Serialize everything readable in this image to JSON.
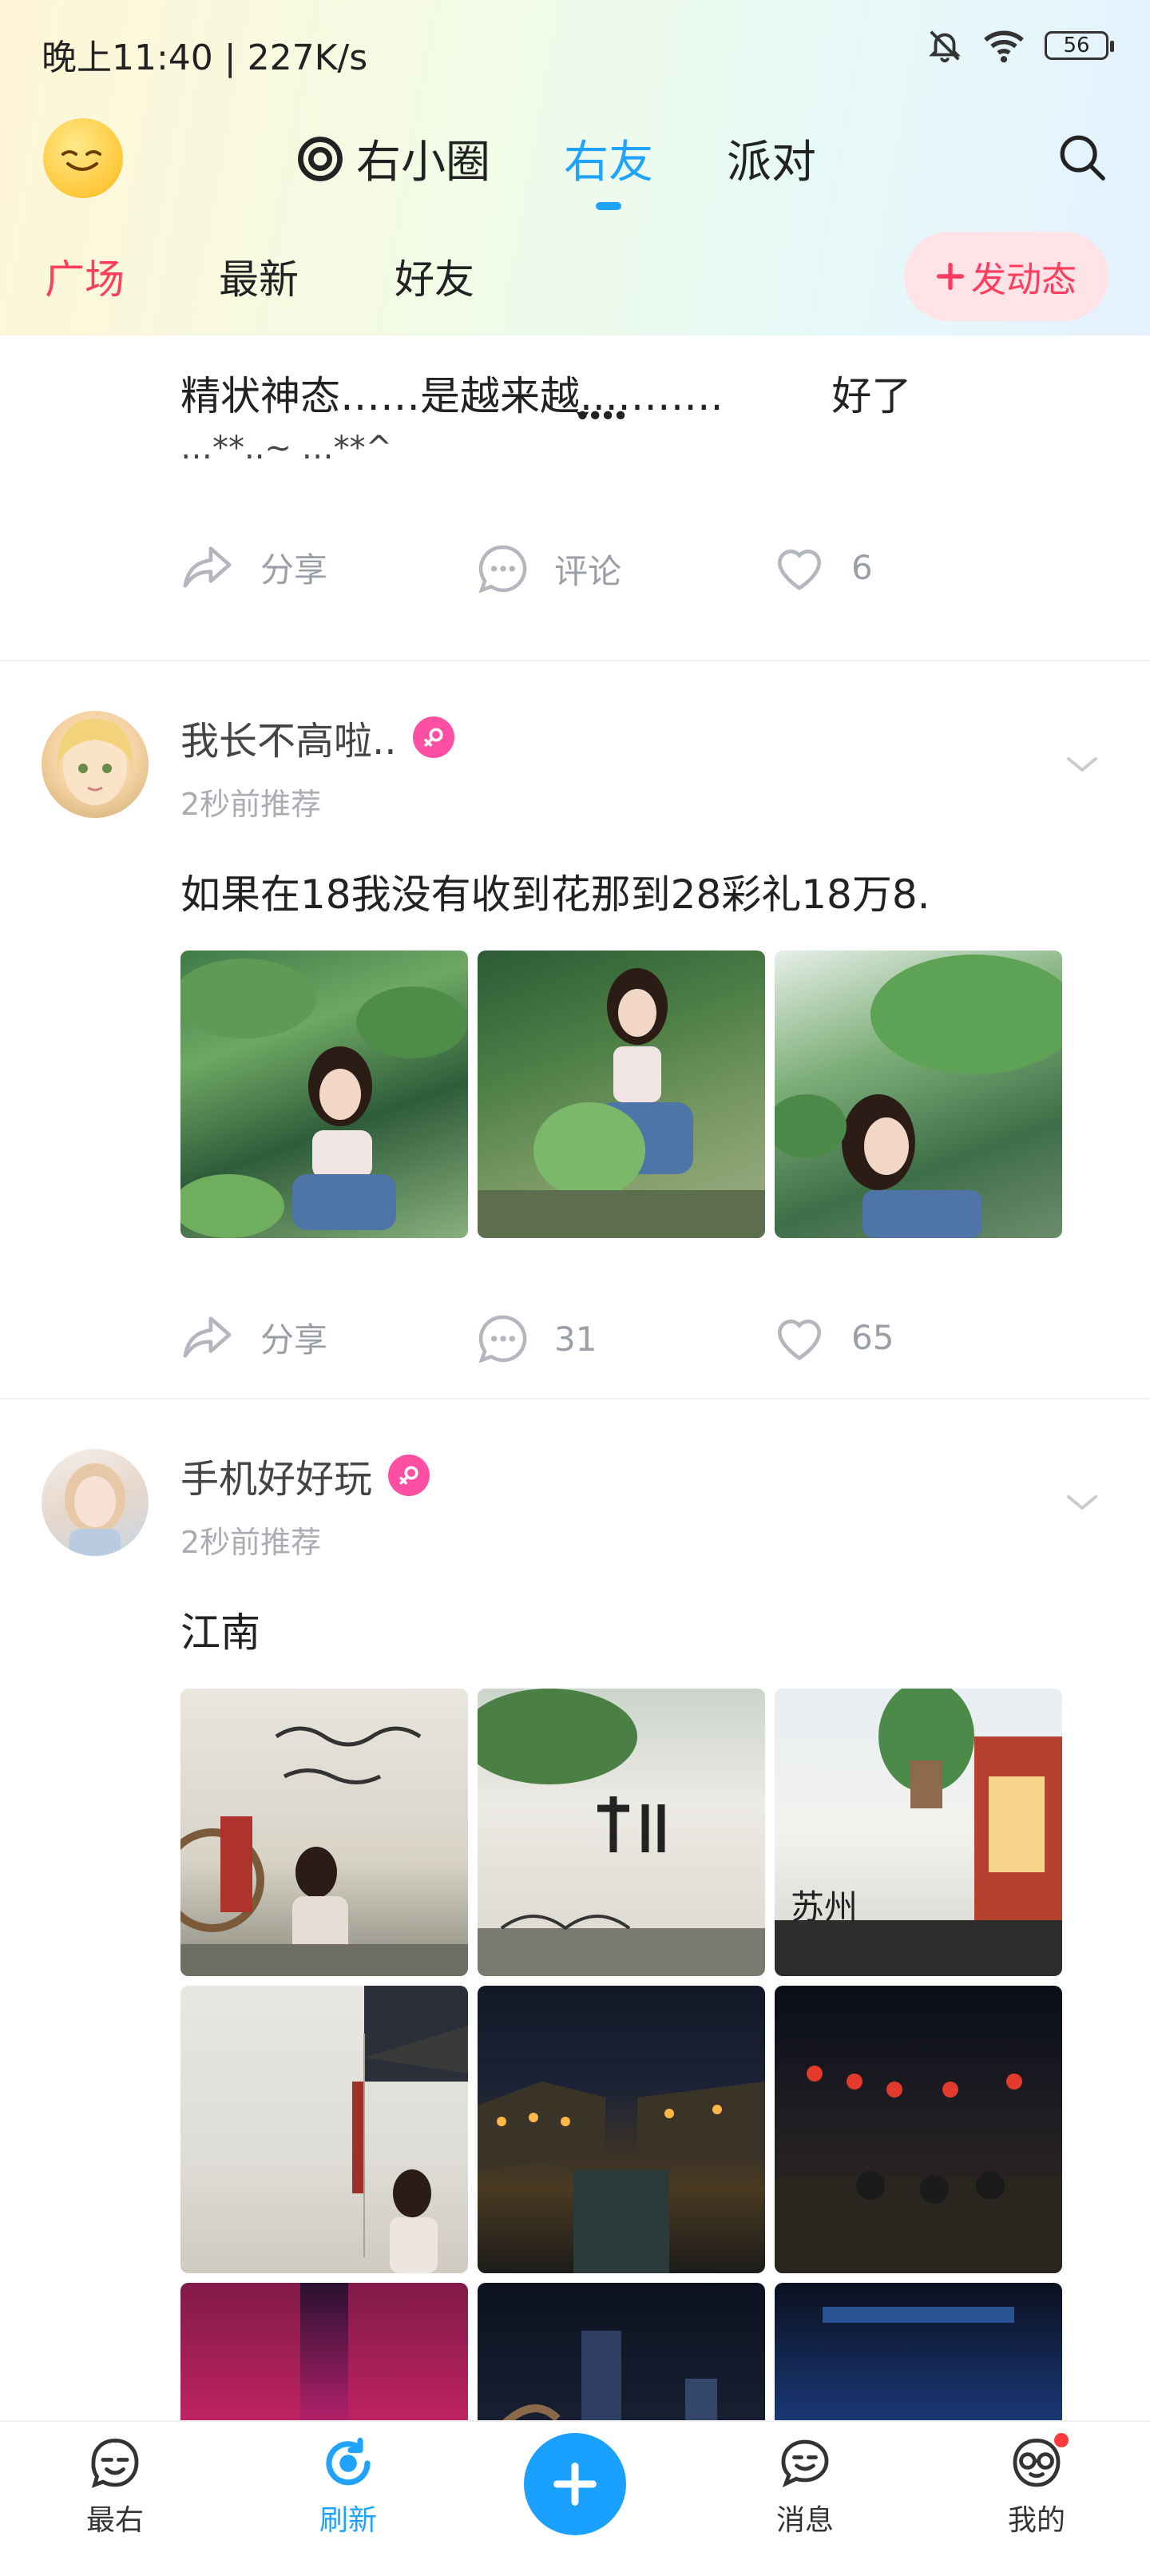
{
  "status_bar": {
    "time": "晚上11:40 | 227K/s",
    "battery": "56"
  },
  "top_nav": {
    "tabs": [
      {
        "label": "右小圈",
        "icon": "circle-at-icon"
      },
      {
        "label": "右友"
      },
      {
        "label": "派对"
      }
    ],
    "active_tab": "右友"
  },
  "sub_nav": {
    "tabs": [
      "广场",
      "最新",
      "好友"
    ],
    "active": "广场",
    "post_button": "发动态"
  },
  "posts": [
    {
      "text_line1": "精状神态……是越来越.̣̥̬̣̣̩.̣̥.̣̥.̣̥…….",
      "text_line1_end": "好了",
      "text_line2": "…**..~ …**^",
      "actions": {
        "share": "分享",
        "comment": "评论",
        "likes": "6"
      }
    },
    {
      "user": "我长不高啦..",
      "time": "2秒前推荐",
      "text": "如果在18我没有收到花那到28彩礼18万8.",
      "actions": {
        "share": "分享",
        "comment": "31",
        "likes": "65"
      }
    },
    {
      "user": "手机好好玩",
      "time": "2秒前推荐",
      "text": "江南",
      "photo_texts": [
        "苏州"
      ]
    }
  ],
  "bottom_nav": {
    "items": [
      "最右",
      "刷新",
      "消息",
      "我的"
    ],
    "active": "刷新"
  },
  "colors": {
    "accent_blue": "#1fa3ff",
    "accent_red": "#ff3d5f",
    "badge_pink": "#ff4fa3"
  }
}
